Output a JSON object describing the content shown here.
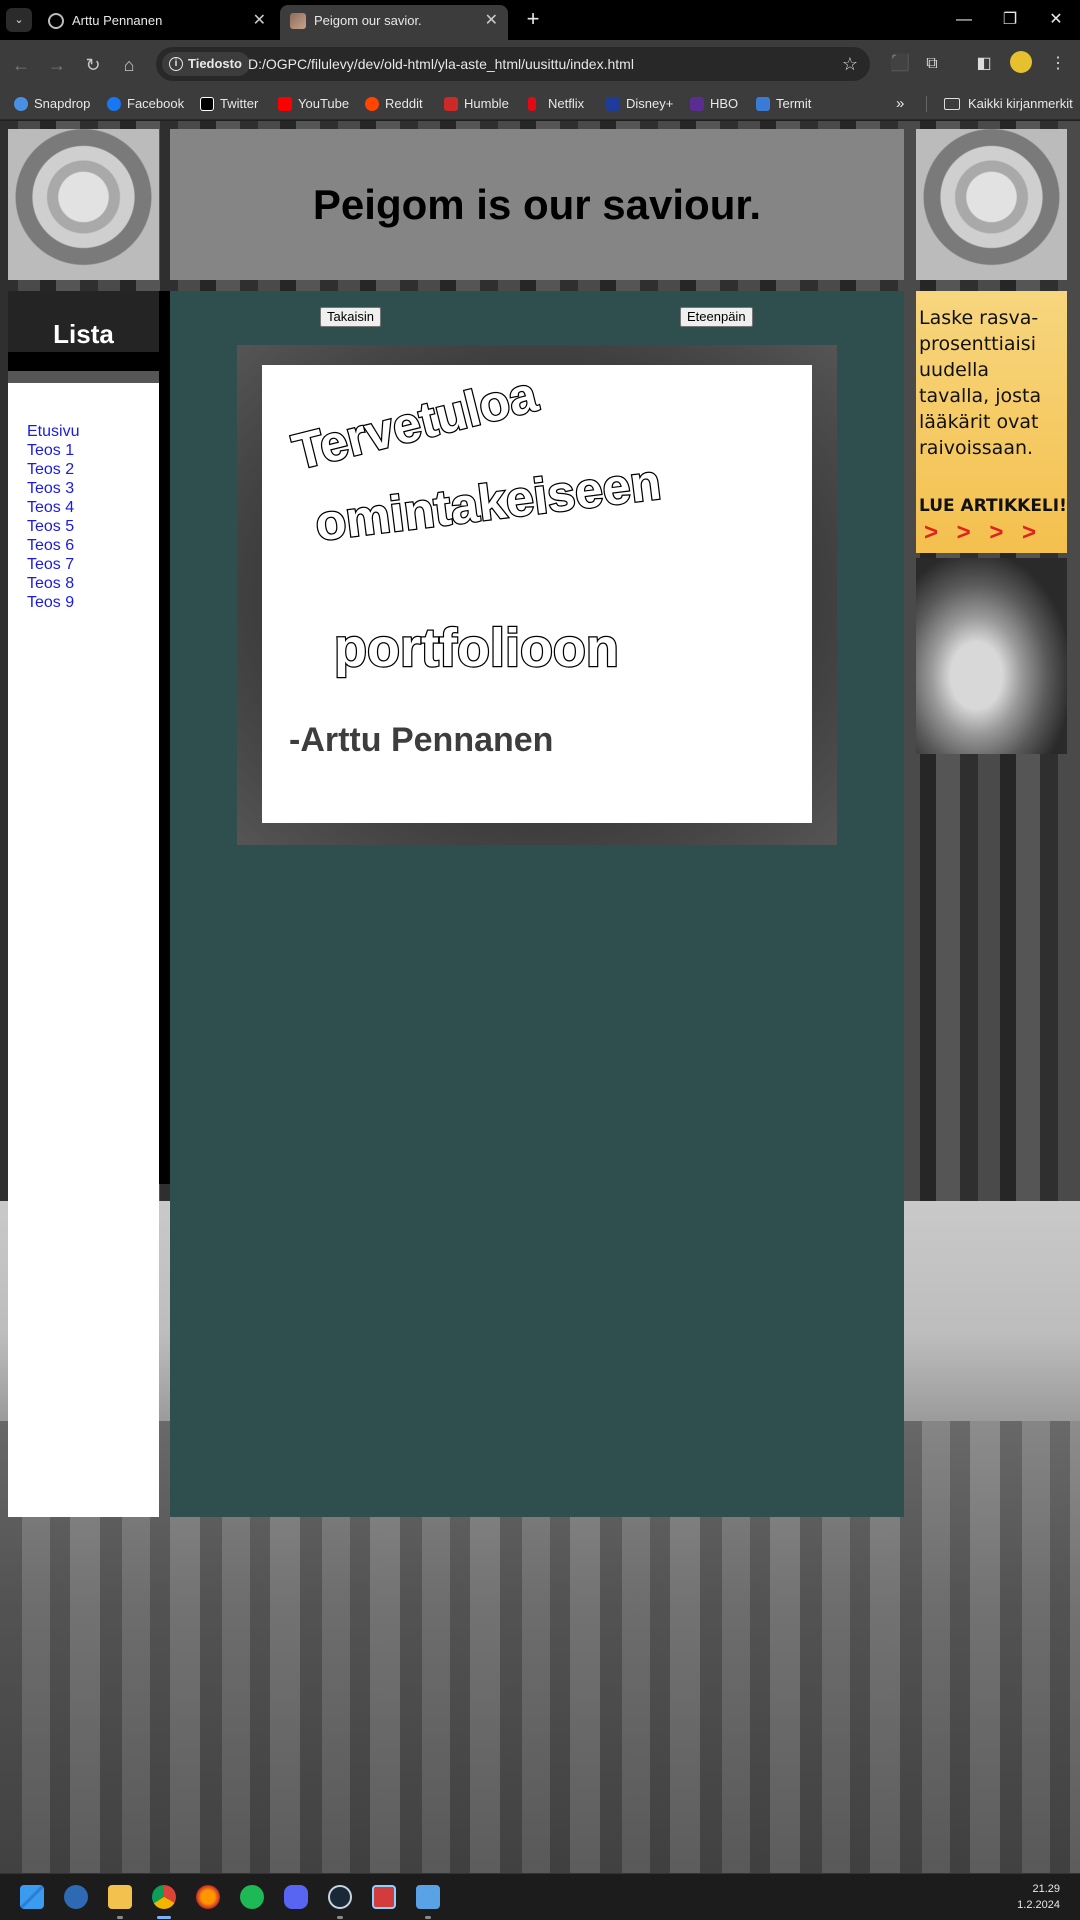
{
  "browser": {
    "tabs": [
      {
        "title": "Arttu Pennanen",
        "active": false
      },
      {
        "title": "Peigom our savior.",
        "active": true
      }
    ],
    "site_chip": "Tiedosto",
    "url": "D:/OGPC/filulevy/dev/old-html/yla-aste_html/uusittu/index.html",
    "extension_badge": "1",
    "bookmarks": [
      {
        "label": "Snapdrop",
        "icon": "snapdrop-icon",
        "color": "#4a90e2"
      },
      {
        "label": "Facebook",
        "icon": "facebook-icon",
        "color": "#1877f2"
      },
      {
        "label": "Twitter",
        "icon": "x-icon",
        "color": "#000000"
      },
      {
        "label": "YouTube",
        "icon": "youtube-icon",
        "color": "#ff0000"
      },
      {
        "label": "Reddit",
        "icon": "reddit-icon",
        "color": "#ff4500"
      },
      {
        "label": "Humble",
        "icon": "humble-icon",
        "color": "#cc2929"
      },
      {
        "label": "Netflix",
        "icon": "netflix-icon",
        "color": "#e50914"
      },
      {
        "label": "Disney+",
        "icon": "disney-icon",
        "color": "#1f3c9a"
      },
      {
        "label": "HBO",
        "icon": "hbo-icon",
        "color": "#5b2c91"
      },
      {
        "label": "Termit",
        "icon": "termit-icon",
        "color": "#3a7bd5"
      }
    ],
    "bookmarks_more": "»",
    "all_bookmarks": "Kaikki kirjanmerkit"
  },
  "page": {
    "title": "Peigom is our saviour.",
    "sidebar": {
      "heading": "Lista",
      "links": [
        "Etusivu",
        "Teos 1",
        "Teos 2",
        "Teos 3",
        "Teos 4",
        "Teos 5",
        "Teos 6",
        "Teos 7",
        "Teos 8",
        "Teos 9"
      ]
    },
    "main": {
      "back_button": "Takaisin",
      "forward_button": "Eteenpäin",
      "welcome_lines": [
        "Tervetuloa",
        "omintakeiseen",
        "portfolioon"
      ],
      "author": "-Arttu Pennanen",
      "background_color": "#2f4f4f"
    },
    "ad": {
      "text": "Laske rasva-prosenttiaisi uudella tavalla, josta lääkärit ovat raivoissaan.",
      "cta": "LUE ARTIKKELI!",
      "arrows": "> > > >"
    }
  },
  "taskbar": {
    "apps": [
      "start-icon",
      "search-icon",
      "file-explorer-icon",
      "chrome-icon",
      "firefox-icon",
      "spotify-icon",
      "discord-icon",
      "steam-icon",
      "snipping-tool-icon",
      "notepad-icon"
    ],
    "time": "21.29",
    "date": "1.2.2024"
  }
}
